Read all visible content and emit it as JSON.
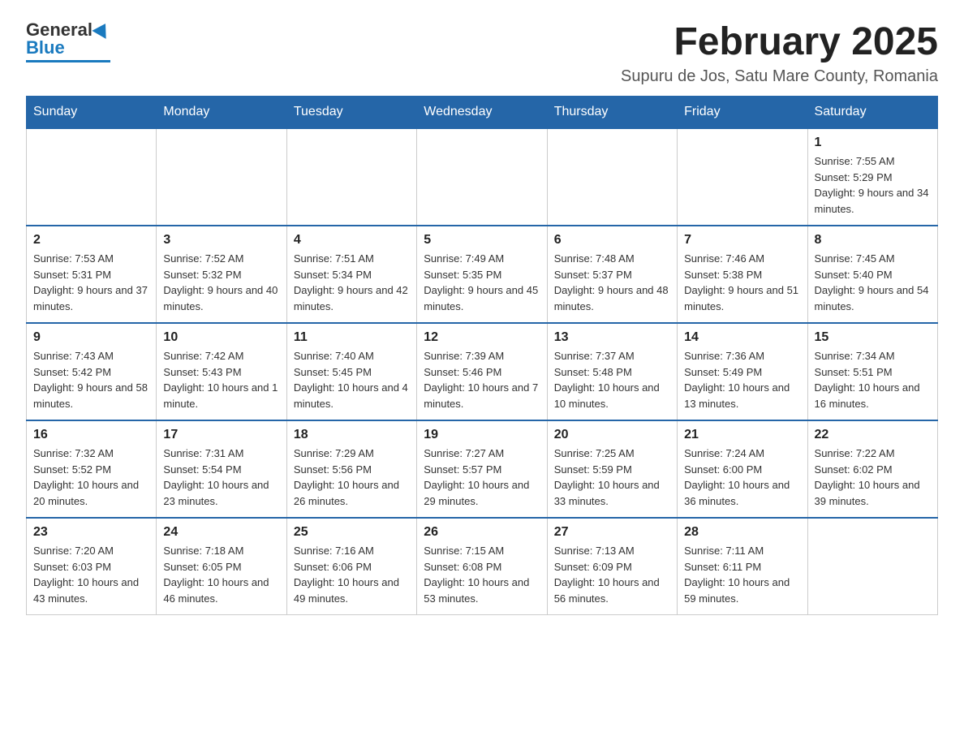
{
  "logo": {
    "general": "General",
    "blue": "Blue"
  },
  "header": {
    "title": "February 2025",
    "location": "Supuru de Jos, Satu Mare County, Romania"
  },
  "weekdays": [
    "Sunday",
    "Monday",
    "Tuesday",
    "Wednesday",
    "Thursday",
    "Friday",
    "Saturday"
  ],
  "weeks": [
    [
      {
        "day": "",
        "info": ""
      },
      {
        "day": "",
        "info": ""
      },
      {
        "day": "",
        "info": ""
      },
      {
        "day": "",
        "info": ""
      },
      {
        "day": "",
        "info": ""
      },
      {
        "day": "",
        "info": ""
      },
      {
        "day": "1",
        "info": "Sunrise: 7:55 AM\nSunset: 5:29 PM\nDaylight: 9 hours and 34 minutes."
      }
    ],
    [
      {
        "day": "2",
        "info": "Sunrise: 7:53 AM\nSunset: 5:31 PM\nDaylight: 9 hours and 37 minutes."
      },
      {
        "day": "3",
        "info": "Sunrise: 7:52 AM\nSunset: 5:32 PM\nDaylight: 9 hours and 40 minutes."
      },
      {
        "day": "4",
        "info": "Sunrise: 7:51 AM\nSunset: 5:34 PM\nDaylight: 9 hours and 42 minutes."
      },
      {
        "day": "5",
        "info": "Sunrise: 7:49 AM\nSunset: 5:35 PM\nDaylight: 9 hours and 45 minutes."
      },
      {
        "day": "6",
        "info": "Sunrise: 7:48 AM\nSunset: 5:37 PM\nDaylight: 9 hours and 48 minutes."
      },
      {
        "day": "7",
        "info": "Sunrise: 7:46 AM\nSunset: 5:38 PM\nDaylight: 9 hours and 51 minutes."
      },
      {
        "day": "8",
        "info": "Sunrise: 7:45 AM\nSunset: 5:40 PM\nDaylight: 9 hours and 54 minutes."
      }
    ],
    [
      {
        "day": "9",
        "info": "Sunrise: 7:43 AM\nSunset: 5:42 PM\nDaylight: 9 hours and 58 minutes."
      },
      {
        "day": "10",
        "info": "Sunrise: 7:42 AM\nSunset: 5:43 PM\nDaylight: 10 hours and 1 minute."
      },
      {
        "day": "11",
        "info": "Sunrise: 7:40 AM\nSunset: 5:45 PM\nDaylight: 10 hours and 4 minutes."
      },
      {
        "day": "12",
        "info": "Sunrise: 7:39 AM\nSunset: 5:46 PM\nDaylight: 10 hours and 7 minutes."
      },
      {
        "day": "13",
        "info": "Sunrise: 7:37 AM\nSunset: 5:48 PM\nDaylight: 10 hours and 10 minutes."
      },
      {
        "day": "14",
        "info": "Sunrise: 7:36 AM\nSunset: 5:49 PM\nDaylight: 10 hours and 13 minutes."
      },
      {
        "day": "15",
        "info": "Sunrise: 7:34 AM\nSunset: 5:51 PM\nDaylight: 10 hours and 16 minutes."
      }
    ],
    [
      {
        "day": "16",
        "info": "Sunrise: 7:32 AM\nSunset: 5:52 PM\nDaylight: 10 hours and 20 minutes."
      },
      {
        "day": "17",
        "info": "Sunrise: 7:31 AM\nSunset: 5:54 PM\nDaylight: 10 hours and 23 minutes."
      },
      {
        "day": "18",
        "info": "Sunrise: 7:29 AM\nSunset: 5:56 PM\nDaylight: 10 hours and 26 minutes."
      },
      {
        "day": "19",
        "info": "Sunrise: 7:27 AM\nSunset: 5:57 PM\nDaylight: 10 hours and 29 minutes."
      },
      {
        "day": "20",
        "info": "Sunrise: 7:25 AM\nSunset: 5:59 PM\nDaylight: 10 hours and 33 minutes."
      },
      {
        "day": "21",
        "info": "Sunrise: 7:24 AM\nSunset: 6:00 PM\nDaylight: 10 hours and 36 minutes."
      },
      {
        "day": "22",
        "info": "Sunrise: 7:22 AM\nSunset: 6:02 PM\nDaylight: 10 hours and 39 minutes."
      }
    ],
    [
      {
        "day": "23",
        "info": "Sunrise: 7:20 AM\nSunset: 6:03 PM\nDaylight: 10 hours and 43 minutes."
      },
      {
        "day": "24",
        "info": "Sunrise: 7:18 AM\nSunset: 6:05 PM\nDaylight: 10 hours and 46 minutes."
      },
      {
        "day": "25",
        "info": "Sunrise: 7:16 AM\nSunset: 6:06 PM\nDaylight: 10 hours and 49 minutes."
      },
      {
        "day": "26",
        "info": "Sunrise: 7:15 AM\nSunset: 6:08 PM\nDaylight: 10 hours and 53 minutes."
      },
      {
        "day": "27",
        "info": "Sunrise: 7:13 AM\nSunset: 6:09 PM\nDaylight: 10 hours and 56 minutes."
      },
      {
        "day": "28",
        "info": "Sunrise: 7:11 AM\nSunset: 6:11 PM\nDaylight: 10 hours and 59 minutes."
      },
      {
        "day": "",
        "info": ""
      }
    ]
  ]
}
